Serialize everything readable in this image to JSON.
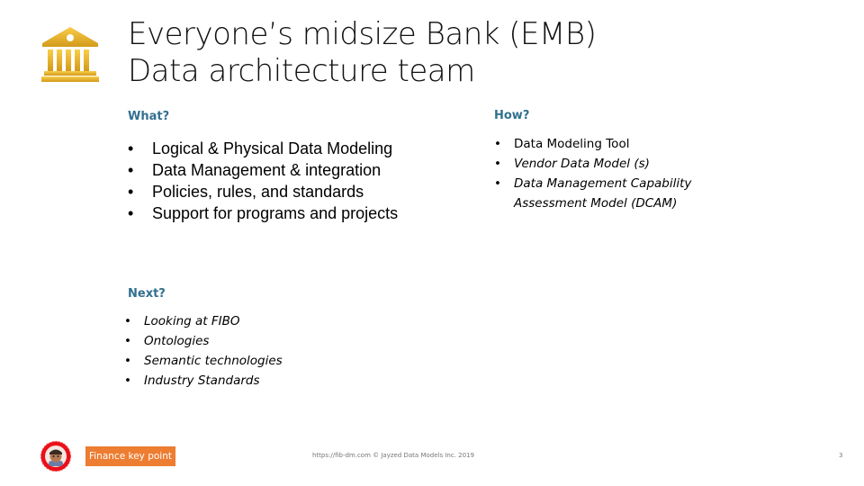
{
  "title": {
    "line1": "Everyone’s  midsize Bank (EMB)",
    "line2": "Data architecture team"
  },
  "icons": {
    "bank": "bank-building-icon",
    "mascot": "mascot-badge-icon"
  },
  "colors": {
    "heading": "#31708f",
    "icon_gold_top": "#f7c948",
    "icon_gold_bottom": "#d9a21b",
    "button_orange": "#ed7d31"
  },
  "what": {
    "heading": "What?",
    "items": [
      "Logical & Physical Data Modeling",
      "Data Management & integration",
      "Policies, rules, and standards",
      "Support for programs and projects"
    ]
  },
  "how": {
    "heading": "How?",
    "items": [
      "Data Modeling Tool",
      "Vendor Data Model (s)",
      "Data Management Capability",
      "Assessment Model (DCAM)"
    ]
  },
  "next": {
    "heading": "Next?",
    "items": [
      "Looking at FIBO",
      "Ontologies",
      "Semantic technologies",
      "Industry Standards"
    ]
  },
  "footer": {
    "button_label": "Finance key point",
    "copyright": "https://fib-dm.com © Jayzed Data Models Inc. 2019",
    "page_number": "3"
  },
  "bullet": "•"
}
